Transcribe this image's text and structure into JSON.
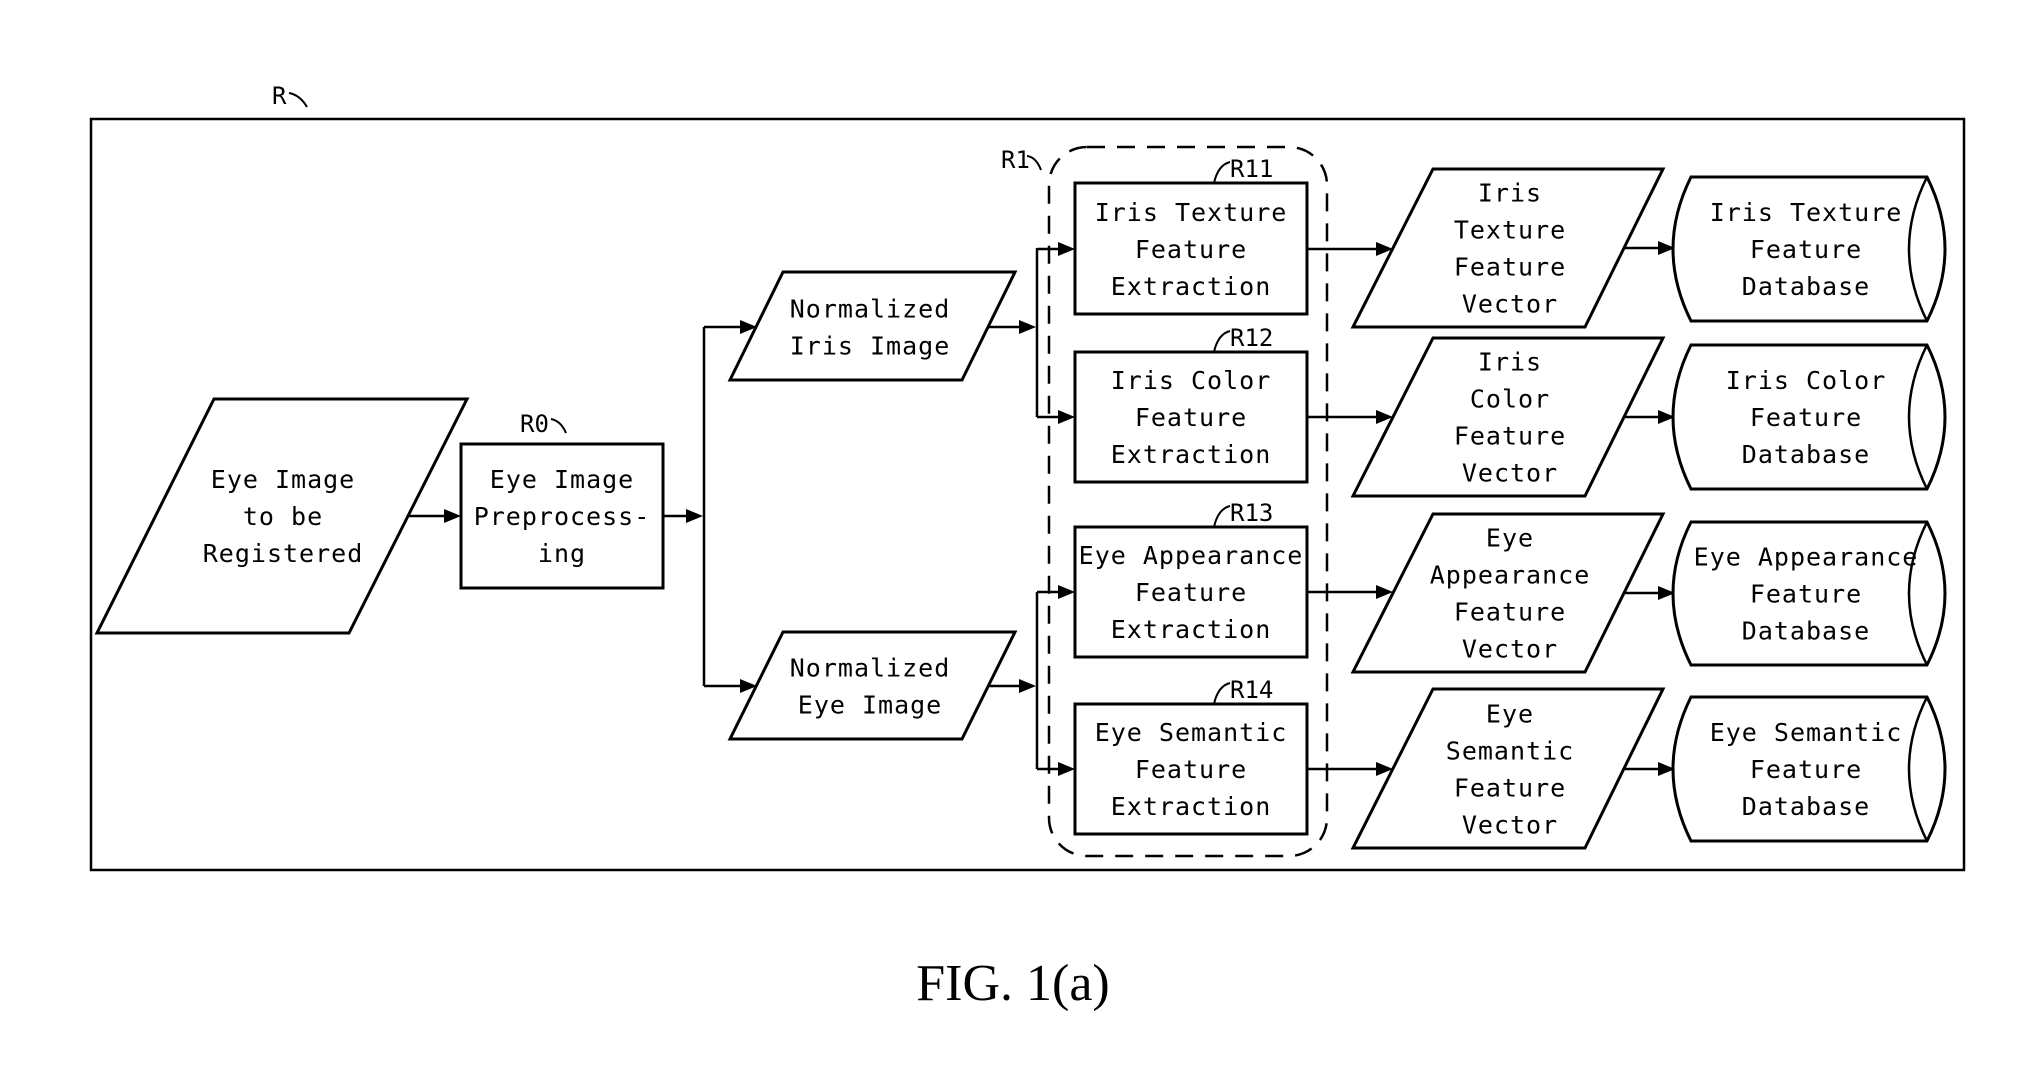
{
  "figure": {
    "caption": "FIG. 1(a)",
    "ref_outer": "R",
    "ref_group": "R1"
  },
  "input": {
    "ref": "",
    "lines": [
      "Eye Image",
      "to be",
      "Registered"
    ]
  },
  "preprocessing": {
    "ref": "R0",
    "lines": [
      "Eye Image",
      "Preprocess-",
      "ing"
    ]
  },
  "normalized": [
    {
      "id": "normalized-iris-image",
      "lines": [
        "Normalized",
        "Iris Image"
      ]
    },
    {
      "id": "normalized-eye-image",
      "lines": [
        "Normalized",
        "Eye Image"
      ]
    }
  ],
  "extractors": [
    {
      "id": "iris-texture-feature-extraction",
      "ref": "R11",
      "lines": [
        "Iris Texture",
        "Feature",
        "Extraction"
      ],
      "source": 0
    },
    {
      "id": "iris-color-feature-extraction",
      "ref": "R12",
      "lines": [
        "Iris Color",
        "Feature",
        "Extraction"
      ],
      "source": 0
    },
    {
      "id": "eye-appearance-feature-extraction",
      "ref": "R13",
      "lines": [
        "Eye Appearance",
        "Feature",
        "Extraction"
      ],
      "source": 1
    },
    {
      "id": "eye-semantic-feature-extraction",
      "ref": "R14",
      "lines": [
        "Eye Semantic",
        "Feature",
        "Extraction"
      ],
      "source": 1
    }
  ],
  "vectors": [
    {
      "id": "iris-texture-feature-vector",
      "lines": [
        "Iris",
        "Texture",
        "Feature",
        "Vector"
      ]
    },
    {
      "id": "iris-color-feature-vector",
      "lines": [
        "Iris",
        "Color",
        "Feature",
        "Vector"
      ]
    },
    {
      "id": "eye-appearance-feature-vector",
      "lines": [
        "Eye",
        "Appearance",
        "Feature",
        "Vector"
      ]
    },
    {
      "id": "eye-semantic-feature-vector",
      "lines": [
        "Eye",
        "Semantic",
        "Feature",
        "Vector"
      ]
    }
  ],
  "databases": [
    {
      "id": "iris-texture-feature-database",
      "lines": [
        "Iris Texture",
        "Feature",
        "Database"
      ]
    },
    {
      "id": "iris-color-feature-database",
      "lines": [
        "Iris Color",
        "Feature",
        "Database"
      ]
    },
    {
      "id": "eye-appearance-feature-database",
      "lines": [
        "Eye Appearance",
        "Feature",
        "Database"
      ]
    },
    {
      "id": "eye-semantic-feature-database",
      "lines": [
        "Eye Semantic",
        "Feature",
        "Database"
      ]
    }
  ]
}
